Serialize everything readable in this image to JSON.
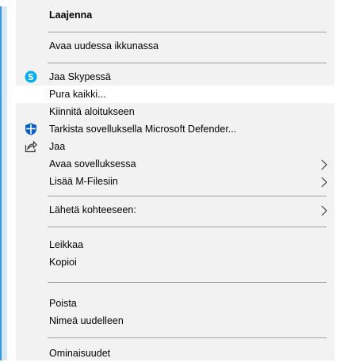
{
  "menu": {
    "items": {
      "expand": "Laajenna",
      "open_new_window": "Avaa uudessa ikkunassa",
      "share_skype": "Jaa Skypessä",
      "extract_all": "Pura kaikki...",
      "pin_start": "Kiinnitä aloitukseen",
      "scan_defender": "Tarkista sovelluksella Microsoft Defender...",
      "share": "Jaa",
      "open_with": "Avaa sovelluksessa",
      "add_mfiles": "Lisää M-Filesiin",
      "send_to": "Lähetä kohteeseen:",
      "cut": "Leikkaa",
      "copy": "Kopioi",
      "delete": "Poista",
      "rename": "Nimeä uudelleen",
      "properties": "Ominaisuudet"
    },
    "icons": {
      "skype": "skype-icon",
      "defender": "defender-shield-icon",
      "share": "share-icon",
      "submenu": "chevron-right-icon"
    },
    "colors": {
      "menu_bg": "#f2f2f2",
      "hover_bg": "#ffffff",
      "separator": "#a0a0a0",
      "skype_blue": "#00aff0",
      "defender_blue": "#0a5fc4",
      "accent_strip": "#3a96dd"
    }
  }
}
